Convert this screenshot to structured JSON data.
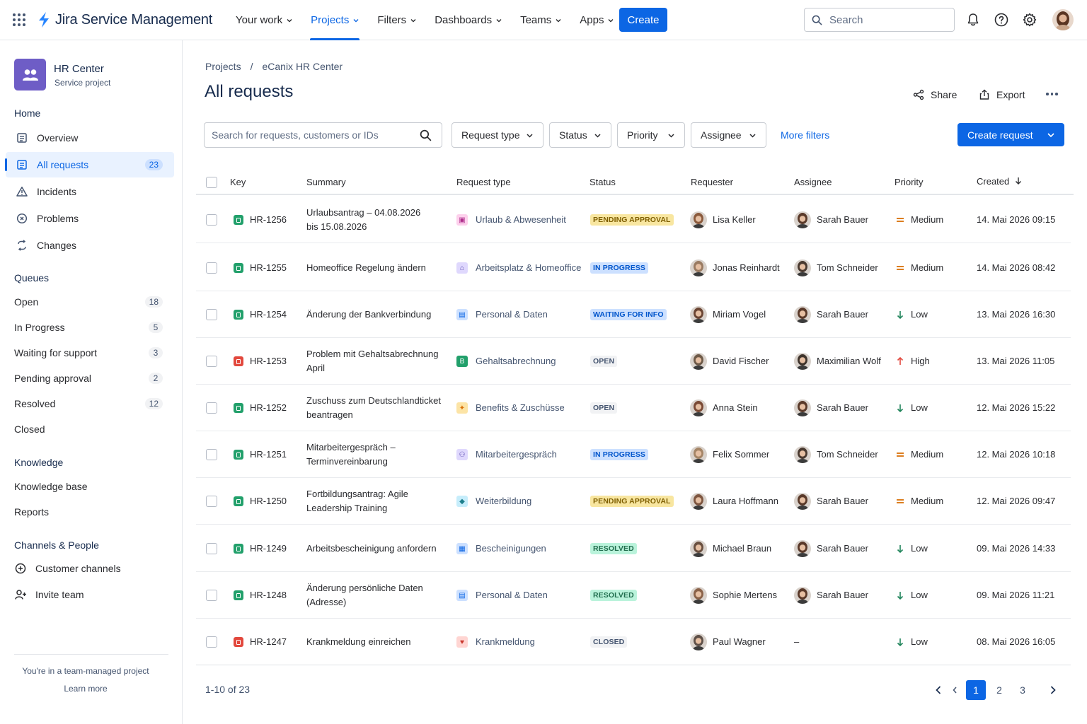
{
  "app": {
    "name": "Jira Service Management",
    "nav": [
      {
        "label": "Your work"
      },
      {
        "label": "Projects"
      },
      {
        "label": "Filters"
      },
      {
        "label": "Dashboards"
      },
      {
        "label": "Teams"
      },
      {
        "label": "Apps"
      }
    ],
    "active_nav": "Projects",
    "create_label": "Create",
    "search_placeholder": "Search",
    "accent": "#0c66e4"
  },
  "sidebar": {
    "project_name": "HR Center",
    "project_type": "Service project",
    "home_heading": "Home",
    "home_items": [
      {
        "label": "Overview",
        "icon": "overview-icon"
      },
      {
        "label": "All requests",
        "icon": "requests-icon",
        "count": "23"
      },
      {
        "label": "Incidents",
        "icon": "warning-icon"
      },
      {
        "label": "Problems",
        "icon": "problem-icon"
      },
      {
        "label": "Changes",
        "icon": "changes-icon"
      }
    ],
    "queues_heading": "Queues",
    "queues": [
      {
        "label": "Open",
        "count": "18"
      },
      {
        "label": "In Progress",
        "count": "5"
      },
      {
        "label": "Waiting for support",
        "count": "3"
      },
      {
        "label": "Pending approval",
        "count": "2"
      },
      {
        "label": "Resolved",
        "count": "12"
      },
      {
        "label": "Closed",
        "count": ""
      }
    ],
    "knowledge_heading": "Knowledge",
    "knowledge_items": [
      {
        "label": "Knowledge base"
      },
      {
        "label": "Reports"
      }
    ],
    "channels_heading": "Channels & People",
    "channel_items": [
      {
        "label": "Customer channels",
        "icon": "add-circle-icon"
      },
      {
        "label": "Invite team",
        "icon": "add-person-icon"
      }
    ],
    "footer_note": "You're in a team-managed project",
    "footer_link": "Learn more"
  },
  "main": {
    "breadcrumb": [
      "Projects",
      "eCanix HR Center"
    ],
    "title": "All requests",
    "share_label": "Share",
    "export_label": "Export",
    "search_placeholder": "Search for requests, customers or IDs",
    "filters": [
      "Request type",
      "Status",
      "Priority",
      "Assignee"
    ],
    "more_filters": "More filters",
    "create_request": "Create request",
    "columns": [
      "Key",
      "Summary",
      "Request type",
      "Status",
      "Requester",
      "Assignee",
      "Priority",
      "Created"
    ],
    "rows": [
      {
        "key": "HR-1256",
        "key_color": "#22a06b",
        "summary": [
          "Urlaubsantrag – 04.08.2026",
          "bis 15.08.2026"
        ],
        "rtype": "Urlaub & Abwesenheit",
        "rtype_icon": "calendar-icon",
        "rtype_bg": "#fdd0ec",
        "rtype_fg": "#ae2e8c",
        "rtype_glyph": "▣",
        "status": "PENDING APPROVAL",
        "status_bg": "#f8e6a0",
        "status_fg": "#7f5f01",
        "requester": "Lisa Keller",
        "req_av": "#8b5a3c",
        "assignee": "Sarah Bauer",
        "asg_av": "#5a3a2a",
        "priority": "Medium",
        "prio_type": "medium",
        "created": "14. Mai 2026 09:15"
      },
      {
        "key": "HR-1255",
        "key_color": "#22a06b",
        "summary": [
          "Homeoffice Regelung ändern"
        ],
        "rtype": "Arbeitsplatz & Homeoffice",
        "rtype_icon": "home-icon",
        "rtype_bg": "#dfd8fd",
        "rtype_fg": "#5e4db2",
        "rtype_glyph": "⌂",
        "status": "IN PROGRESS",
        "status_bg": "#cce0ff",
        "status_fg": "#0055cc",
        "requester": "Jonas Reinhardt",
        "req_av": "#9a7b62",
        "assignee": "Tom Schneider",
        "asg_av": "#4a3a30",
        "priority": "Medium",
        "prio_type": "medium",
        "created": "14. Mai 2026 08:42"
      },
      {
        "key": "HR-1254",
        "key_color": "#22a06b",
        "summary": [
          "Änderung der Bankverbindung"
        ],
        "rtype": "Personal & Daten",
        "rtype_icon": "person-card-icon",
        "rtype_bg": "#cce0ff",
        "rtype_fg": "#0c66e4",
        "rtype_glyph": "▤",
        "status": "WAITING FOR INFO",
        "status_bg": "#cce0ff",
        "status_fg": "#0055cc",
        "requester": "Miriam Vogel",
        "req_av": "#6b4533",
        "assignee": "Sarah Bauer",
        "asg_av": "#5a3a2a",
        "priority": "Low",
        "prio_type": "low",
        "created": "13. Mai 2026 16:30"
      },
      {
        "key": "HR-1253",
        "key_color": "#e2483d",
        "summary": [
          "Problem mit Gehaltsabrechnung",
          "April"
        ],
        "rtype": "Gehaltsabrechnung",
        "rtype_icon": "payroll-icon",
        "rtype_bg": "#22a06b",
        "rtype_fg": "#ffffff",
        "rtype_glyph": "B",
        "status": "OPEN",
        "status_bg": "#f1f2f4",
        "status_fg": "#44546f",
        "requester": "David Fischer",
        "req_av": "#6e5a48",
        "assignee": "Maximilian Wolf",
        "asg_av": "#3f342c",
        "priority": "High",
        "prio_type": "high",
        "created": "13. Mai 2026 11:05"
      },
      {
        "key": "HR-1252",
        "key_color": "#22a06b",
        "summary": [
          "Zuschuss zum Deutschlandticket",
          "beantragen"
        ],
        "rtype": "Benefits & Zuschüsse",
        "rtype_icon": "gift-icon",
        "rtype_bg": "#fce4a6",
        "rtype_fg": "#d97008",
        "rtype_glyph": "✦",
        "status": "OPEN",
        "status_bg": "#f1f2f4",
        "status_fg": "#44546f",
        "requester": "Anna Stein",
        "req_av": "#7a4a35",
        "assignee": "Sarah Bauer",
        "asg_av": "#5a3a2a",
        "priority": "Low",
        "prio_type": "low",
        "created": "12. Mai 2026 15:22"
      },
      {
        "key": "HR-1251",
        "key_color": "#22a06b",
        "summary": [
          "Mitarbeitergespräch –",
          "Terminvereinbarung"
        ],
        "rtype": "Mitarbeitergespräch",
        "rtype_icon": "people-icon",
        "rtype_bg": "#dfd8fd",
        "rtype_fg": "#5e4db2",
        "rtype_glyph": "⚇",
        "status": "IN PROGRESS",
        "status_bg": "#cce0ff",
        "status_fg": "#0055cc",
        "requester": "Felix Sommer",
        "req_av": "#a58566",
        "assignee": "Tom Schneider",
        "asg_av": "#4a3a30",
        "priority": "Medium",
        "prio_type": "medium",
        "created": "12. Mai 2026 10:18"
      },
      {
        "key": "HR-1250",
        "key_color": "#22a06b",
        "summary": [
          "Fortbildungsantrag: Agile",
          "Leadership Training"
        ],
        "rtype": "Weiterbildung",
        "rtype_icon": "graduation-cap-icon",
        "rtype_bg": "#c6edfb",
        "rtype_fg": "#1d7f8c",
        "rtype_glyph": "◆",
        "status": "PENDING APPROVAL",
        "status_bg": "#f8e6a0",
        "status_fg": "#7f5f01",
        "requester": "Laura Hoffmann",
        "req_av": "#7e5640",
        "assignee": "Sarah Bauer",
        "asg_av": "#5a3a2a",
        "priority": "Medium",
        "prio_type": "medium",
        "created": "12. Mai 2026 09:47"
      },
      {
        "key": "HR-1249",
        "key_color": "#22a06b",
        "summary": [
          "Arbeitsbescheinigung anfordern"
        ],
        "rtype": "Bescheinigungen",
        "rtype_icon": "document-icon",
        "rtype_bg": "#cce0ff",
        "rtype_fg": "#0c66e4",
        "rtype_glyph": "▦",
        "status": "RESOLVED",
        "status_bg": "#baf3db",
        "status_fg": "#216e4e",
        "requester": "Michael Braun",
        "req_av": "#6a5040",
        "assignee": "Sarah Bauer",
        "asg_av": "#5a3a2a",
        "priority": "Low",
        "prio_type": "low",
        "created": "09. Mai 2026 14:33"
      },
      {
        "key": "HR-1248",
        "key_color": "#22a06b",
        "summary": [
          "Änderung persönliche Daten",
          "(Adresse)"
        ],
        "rtype": "Personal & Daten",
        "rtype_icon": "person-card-icon",
        "rtype_bg": "#cce0ff",
        "rtype_fg": "#0c66e4",
        "rtype_glyph": "▤",
        "status": "RESOLVED",
        "status_bg": "#baf3db",
        "status_fg": "#216e4e",
        "requester": "Sophie Mertens",
        "req_av": "#8a6248",
        "assignee": "Sarah Bauer",
        "asg_av": "#5a3a2a",
        "priority": "Low",
        "prio_type": "low",
        "created": "09. Mai 2026 11:21"
      },
      {
        "key": "HR-1247",
        "key_color": "#e2483d",
        "summary": [
          "Krankmeldung einreichen"
        ],
        "rtype": "Krankmeldung",
        "rtype_icon": "heart-icon",
        "rtype_bg": "#ffd5d2",
        "rtype_fg": "#c9372c",
        "rtype_glyph": "♥",
        "status": "CLOSED",
        "status_bg": "#f1f2f4",
        "status_fg": "#44546f",
        "requester": "Paul Wagner",
        "req_av": "#5e5048",
        "assignee": "–",
        "asg_av": "",
        "priority": "Low",
        "prio_type": "low",
        "created": "08. Mai 2026 16:05"
      }
    ],
    "pagination": {
      "summary": "1-10 of 23",
      "pages": [
        "1",
        "2",
        "3"
      ],
      "current": "1"
    }
  }
}
